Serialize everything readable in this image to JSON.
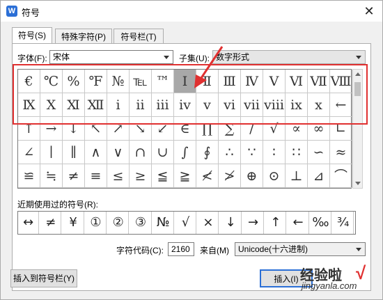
{
  "window": {
    "title": "符号",
    "close_glyph": "✕",
    "app_icon_glyph": "W"
  },
  "tabs": [
    {
      "label": "符号(S)"
    },
    {
      "label": "特殊字符(P)"
    },
    {
      "label": "符号栏(T)"
    }
  ],
  "font": {
    "label": "字体(F):",
    "value": "宋体"
  },
  "subset": {
    "label": "子集(U):",
    "value": "数字形式"
  },
  "symbols": [
    [
      "€",
      "℃",
      "%",
      "℉",
      "№",
      "℡",
      "™",
      "Ⅰ",
      "Ⅱ",
      "Ⅲ",
      "Ⅳ",
      "Ⅴ",
      "Ⅵ",
      "Ⅶ",
      "Ⅷ"
    ],
    [
      "Ⅸ",
      "Ⅹ",
      "Ⅺ",
      "Ⅻ",
      "ⅰ",
      "ⅱ",
      "ⅲ",
      "ⅳ",
      "ⅴ",
      "ⅵ",
      "ⅶ",
      "ⅷ",
      "ⅸ",
      "ⅹ",
      "←"
    ],
    [
      "↑",
      "→",
      "↓",
      "↖",
      "↗",
      "↘",
      "↙",
      "∈",
      "∏",
      "∑",
      "∕",
      "√",
      "∝",
      "∞",
      "∟"
    ],
    [
      "∠",
      "∣",
      "∥",
      "∧",
      "∨",
      "∩",
      "∪",
      "∫",
      "∮",
      "∴",
      "∵",
      "∶",
      "∷",
      "∽",
      "≈"
    ],
    [
      "≌",
      "≒",
      "≠",
      "≡",
      "≤",
      "≥",
      "≦",
      "≧",
      "≮",
      "≯",
      "⊕",
      "⊙",
      "⊥",
      "⊿",
      "⌒"
    ]
  ],
  "selected_symbol": "Ⅰ",
  "recent": {
    "label": "近期使用过的符号(R):",
    "items": [
      "↔",
      "≠",
      "¥",
      "①",
      "②",
      "③",
      "№",
      "√",
      "×",
      "↓",
      "→",
      "↑",
      "←",
      "‰",
      "¾"
    ]
  },
  "char_code": {
    "label": "字符代码(C):",
    "value": "2160",
    "from_label": "来自(M)",
    "from_value": "Unicode(十六进制)"
  },
  "buttons": {
    "insert_to_bar": "插入到符号栏(Y)",
    "insert": "插入(I)"
  },
  "watermark": {
    "text": "经验啦",
    "url": "jingyanla.com",
    "check": "√"
  }
}
